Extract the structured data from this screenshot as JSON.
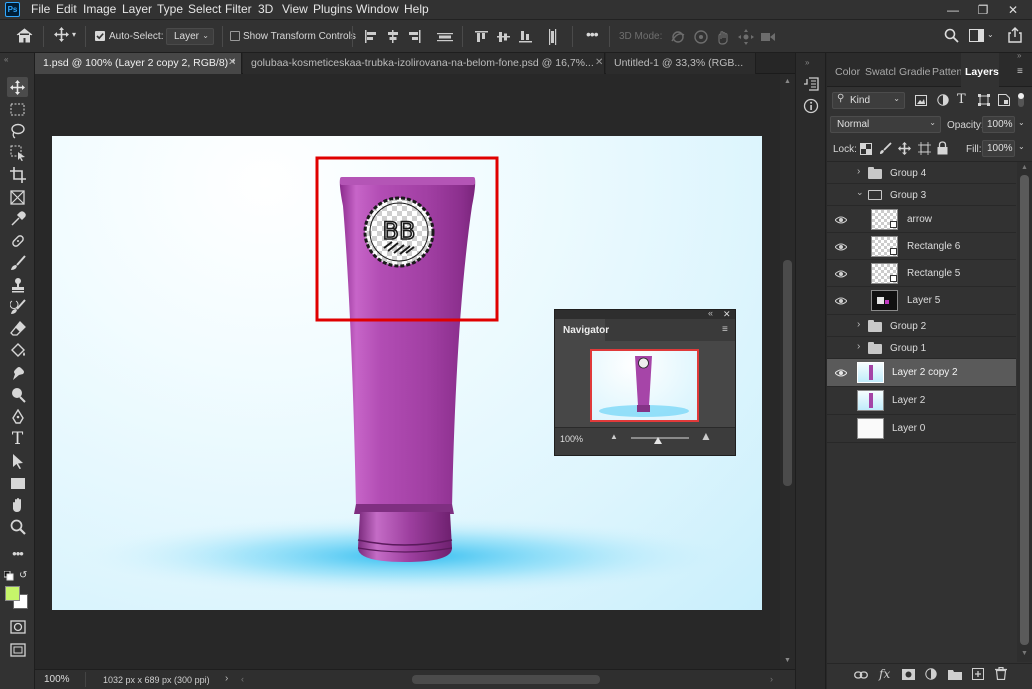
{
  "app": {
    "logo": "Ps"
  },
  "menu": [
    "File",
    "Edit",
    "Image",
    "Layer",
    "Type",
    "Select",
    "Filter",
    "3D",
    "View",
    "Plugins",
    "Window",
    "Help"
  ],
  "options": {
    "auto_select_label": "Auto-Select:",
    "auto_select_checked": true,
    "target": "Layer",
    "transform_label": "Show Transform Controls",
    "mode_3d": "3D Mode:"
  },
  "tabs": [
    {
      "label": "1.psd @ 100% (Layer 2 copy 2, RGB/8) *",
      "active": true
    },
    {
      "label": "golubaa-kosmeticeskaa-trubka-izolirovana-na-belom-fone.psd @ 16,7%...",
      "active": false
    },
    {
      "label": "Untitled-1 @ 33,3% (RGB...",
      "active": false
    }
  ],
  "canvas": {
    "logo_text": "BB",
    "tube_color": "#a43fa4",
    "highlight_color": "#e00000",
    "background_color": "#d6f3fd"
  },
  "status": {
    "zoom": "100%",
    "doc_info": "1032 px x 689 px (300 ppi)"
  },
  "navigator": {
    "title": "Navigator",
    "zoom": "100%"
  },
  "panel": {
    "tabs": [
      "Color",
      "Swatcl",
      "Gradie",
      "Patten",
      "Layers"
    ],
    "active_tab": "Layers",
    "filter_kind": "Kind",
    "blend_mode": "Normal",
    "opacity_label": "Opacity:",
    "opacity": "100%",
    "lock_label": "Lock:",
    "fill_label": "Fill:",
    "fill": "100%"
  },
  "layers": [
    {
      "name": "Group 4",
      "type": "group",
      "visible": false,
      "expanded": false,
      "indent": false,
      "selected": false
    },
    {
      "name": "Group 3",
      "type": "group",
      "visible": false,
      "expanded": true,
      "indent": false,
      "selected": false
    },
    {
      "name": "arrow",
      "type": "layer",
      "visible": true,
      "indent": true,
      "selected": false
    },
    {
      "name": "Rectangle 6",
      "type": "layer",
      "visible": true,
      "indent": true,
      "selected": false
    },
    {
      "name": "Rectangle 5",
      "type": "layer",
      "visible": true,
      "indent": true,
      "selected": false
    },
    {
      "name": "Layer 5",
      "type": "layer",
      "visible": true,
      "indent": true,
      "selected": false
    },
    {
      "name": "Group 2",
      "type": "group",
      "visible": false,
      "expanded": false,
      "indent": false,
      "selected": false
    },
    {
      "name": "Group 1",
      "type": "group",
      "visible": false,
      "expanded": false,
      "indent": false,
      "selected": false
    },
    {
      "name": "Layer 2 copy 2",
      "type": "layer",
      "visible": true,
      "indent": false,
      "selected": true
    },
    {
      "name": "Layer 2",
      "type": "layer",
      "visible": false,
      "indent": false,
      "selected": false
    },
    {
      "name": "Layer 0",
      "type": "layer",
      "visible": false,
      "indent": false,
      "selected": false
    }
  ],
  "colors": {
    "foreground": "#c6f56a",
    "background": "#ffffff"
  }
}
